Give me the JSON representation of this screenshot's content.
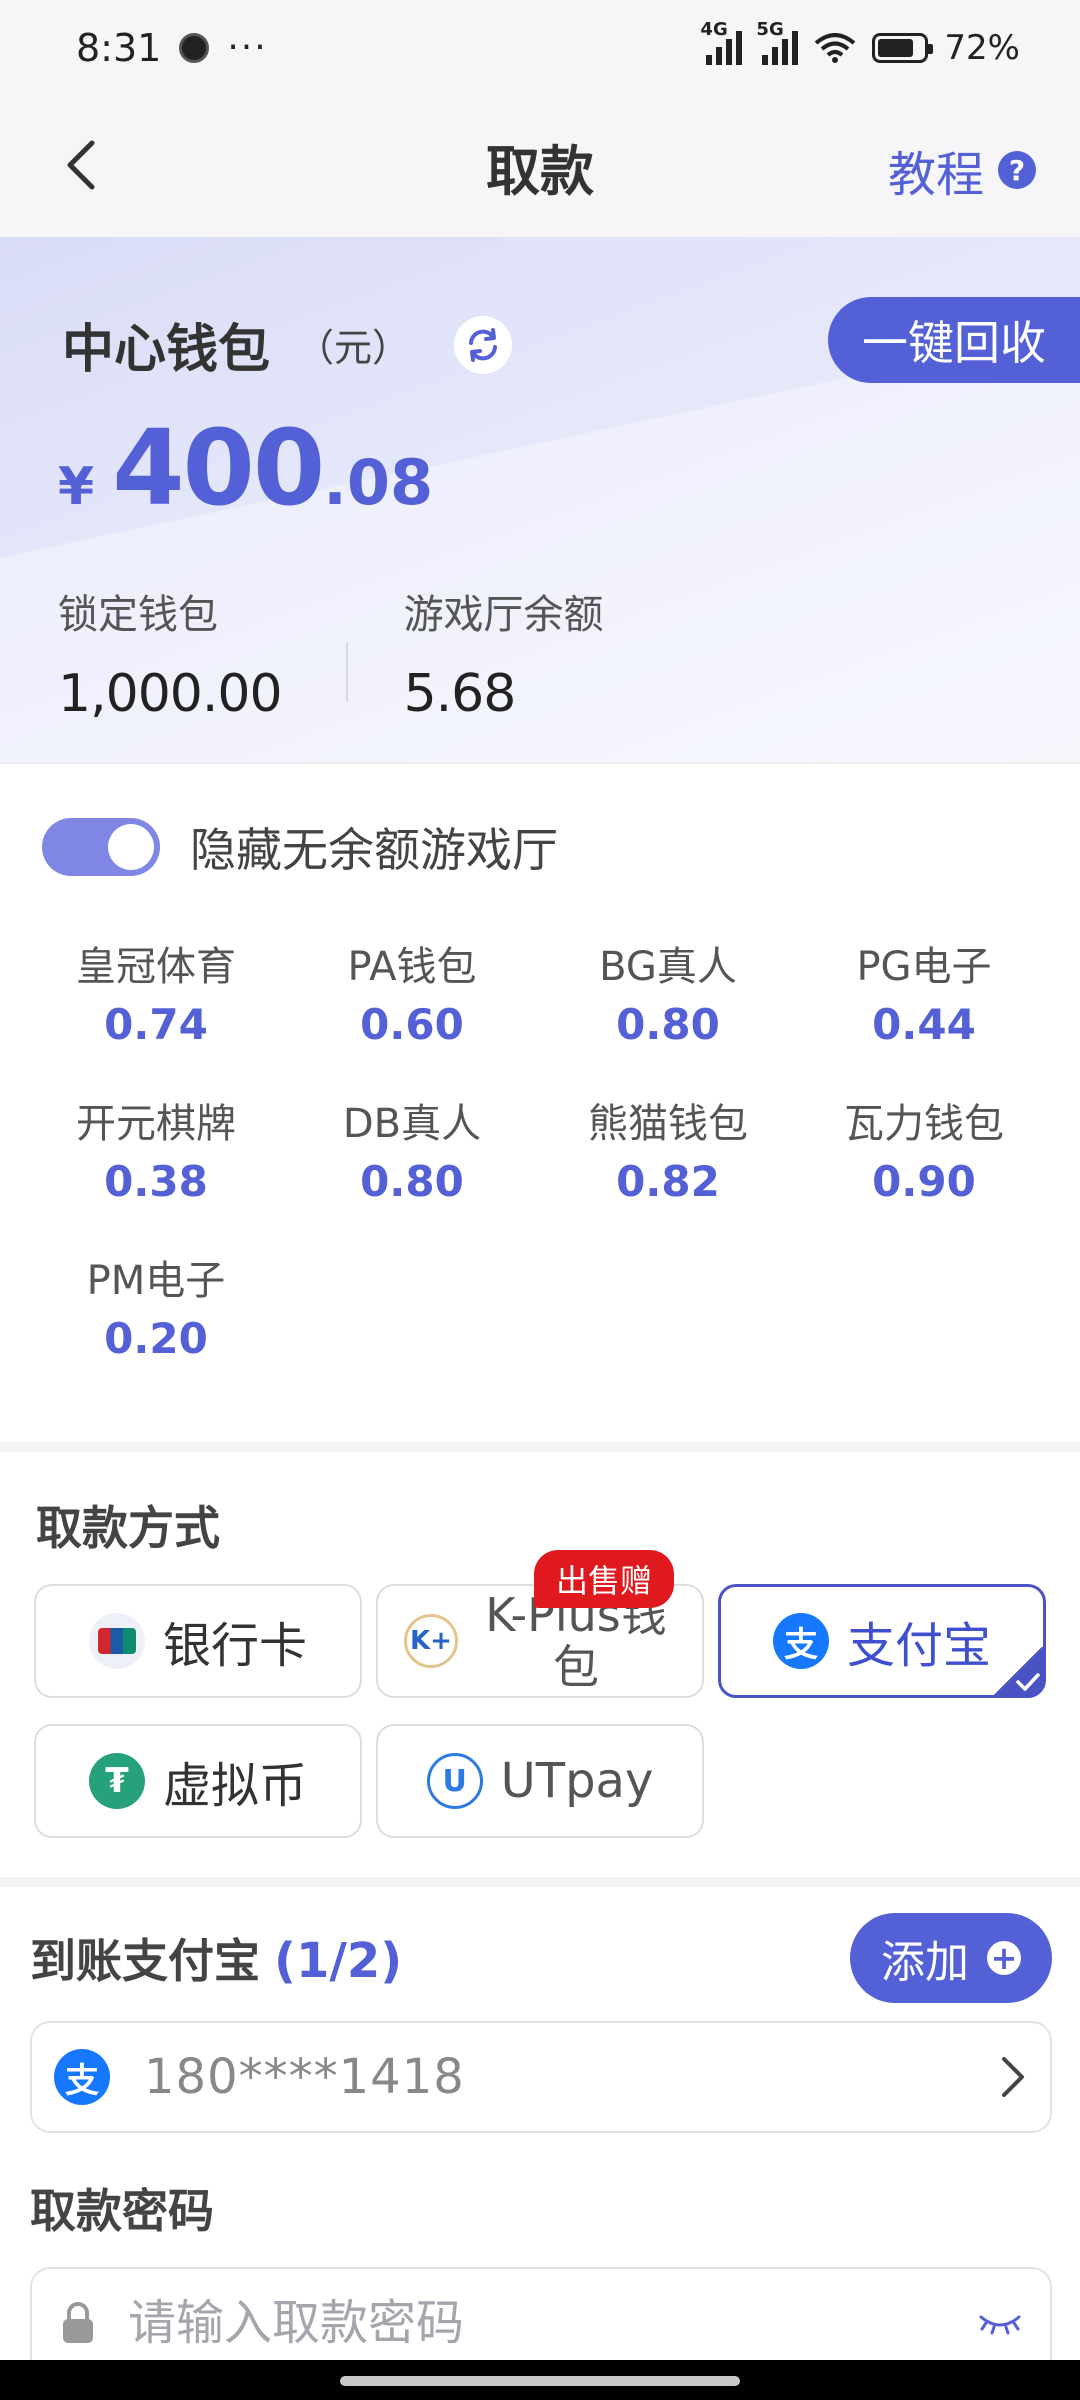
{
  "status_bar": {
    "time": "8:31",
    "dots": "···",
    "network_1": "4G",
    "network_2": "5G",
    "battery": "72%"
  },
  "header": {
    "title": "取款",
    "tutorial_label": "教程",
    "help_glyph": "?"
  },
  "wallet": {
    "title": "中心钱包",
    "unit": "（元）",
    "recall_label": "一键回收",
    "currency": "¥",
    "balance_int": "400",
    "balance_dec": ".08",
    "locked_label": "锁定钱包",
    "locked_value": "1,000.00",
    "hall_label": "游戏厅余额",
    "hall_value": "5.68"
  },
  "games": {
    "toggle_label": "隐藏无余额游戏厅",
    "toggle_on": true,
    "items": [
      {
        "name": "皇冠体育",
        "value": "0.74"
      },
      {
        "name": "PA钱包",
        "value": "0.60"
      },
      {
        "name": "BG真人",
        "value": "0.80"
      },
      {
        "name": "PG电子",
        "value": "0.44"
      },
      {
        "name": "开元棋牌",
        "value": "0.38"
      },
      {
        "name": "DB真人",
        "value": "0.80"
      },
      {
        "name": "熊猫钱包",
        "value": "0.82"
      },
      {
        "name": "瓦力钱包",
        "value": "0.90"
      },
      {
        "name": "PM电子",
        "value": "0.20"
      }
    ]
  },
  "methods": {
    "title": "取款方式",
    "bank_label": "银行卡",
    "kplus_label": "K-Plus钱包",
    "kplus_badge": "出售赠",
    "alipay_label": "支付宝",
    "crypto_label": "虚拟币",
    "utpay_label": "UTpay",
    "selected": "alipay",
    "accent": "#5460d6"
  },
  "account": {
    "title": "到账支付宝",
    "count": "(1/2)",
    "add_label": "添加",
    "account_value": "180****1418",
    "password_title": "取款密码",
    "password_placeholder": "请输入取款密码"
  }
}
